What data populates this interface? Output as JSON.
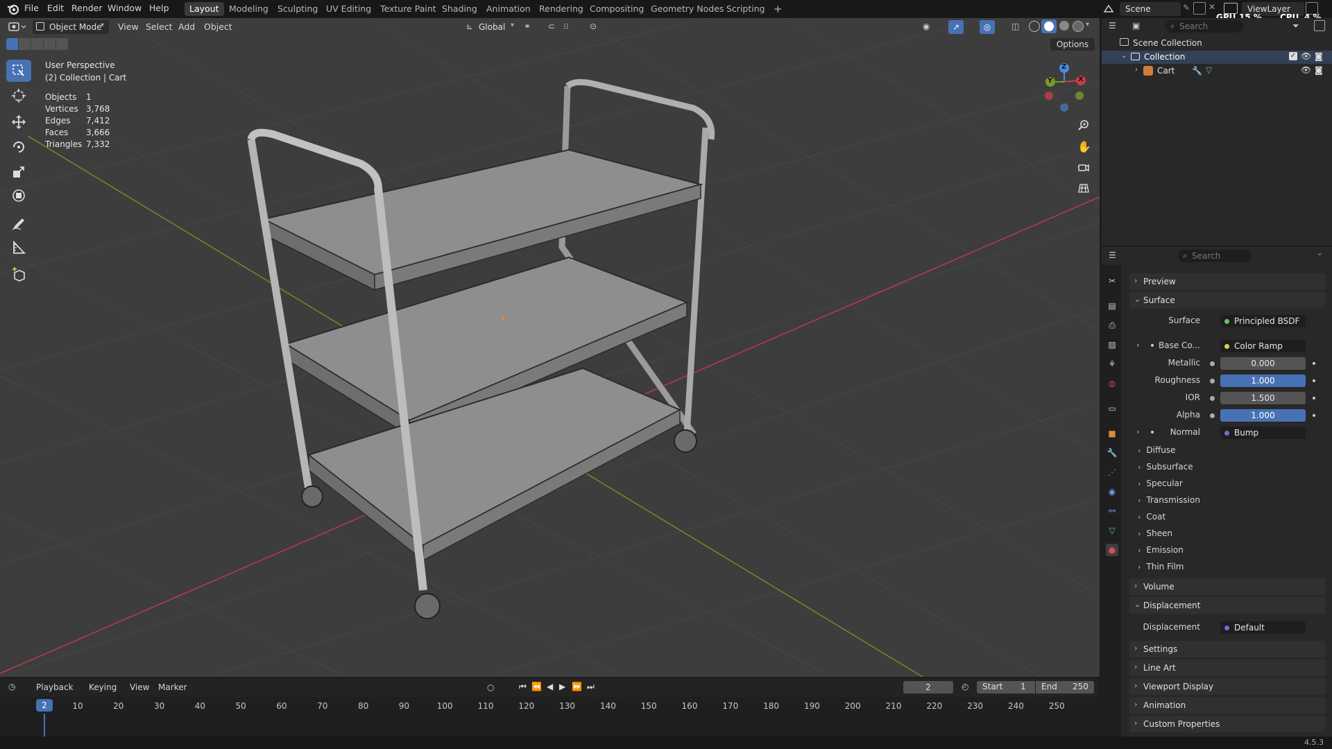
{
  "topbar": {
    "menu": [
      "File",
      "Edit",
      "Render",
      "Window",
      "Help"
    ],
    "workspaces": [
      "Layout",
      "Modeling",
      "Sculpting",
      "UV Editing",
      "Texture Paint",
      "Shading",
      "Animation",
      "Rendering",
      "Compositing",
      "Geometry Nodes",
      "Scripting"
    ],
    "active_workspace": "Layout",
    "add_tab": "+",
    "scene_name": "Scene",
    "view_layer": "ViewLayer",
    "gpu_label": "GPU",
    "gpu_value": "15 %",
    "cpu_label": "CPU",
    "cpu_value": "4 %"
  },
  "viewport_header": {
    "mode": "Object Mode",
    "menus": [
      "View",
      "Select",
      "Add",
      "Object"
    ],
    "transform_orientation": "Global",
    "options_label": "Options"
  },
  "viewport": {
    "perspective": "User Perspective",
    "collection_info": "(2) Collection | Cart",
    "stats": [
      {
        "label": "Objects",
        "value": "1"
      },
      {
        "label": "Vertices",
        "value": "3,768"
      },
      {
        "label": "Edges",
        "value": "7,412"
      },
      {
        "label": "Faces",
        "value": "3,666"
      },
      {
        "label": "Triangles",
        "value": "7,332"
      }
    ],
    "gizmo": {
      "x": "X",
      "y": "Y",
      "z": "Z"
    }
  },
  "outliner": {
    "search_placeholder": "Search",
    "scene_collection": "Scene Collection",
    "collection": "Collection",
    "object": "Cart"
  },
  "properties": {
    "search_placeholder": "Search",
    "preview": "Preview",
    "surface_panel": "Surface",
    "surface_label": "Surface",
    "surface_value": "Principled BSDF",
    "rows": [
      {
        "label": "Base Co...",
        "value": "Color Ramp"
      },
      {
        "label": "Metallic",
        "value": "0.000"
      },
      {
        "label": "Roughness",
        "value": "1.000"
      },
      {
        "label": "IOR",
        "value": "1.500"
      },
      {
        "label": "Alpha",
        "value": "1.000"
      },
      {
        "label": "Normal",
        "value": "Bump"
      }
    ],
    "subpanels": [
      "Diffuse",
      "Subsurface",
      "Specular",
      "Transmission",
      "Coat",
      "Sheen",
      "Emission",
      "Thin Film"
    ],
    "volume": "Volume",
    "displacement_panel": "Displacement",
    "displacement_label": "Displacement",
    "displacement_value": "Default",
    "bottom_panels": [
      "Settings",
      "Line Art",
      "Viewport Display",
      "Animation",
      "Custom Properties"
    ]
  },
  "timeline": {
    "menus": [
      "Playback",
      "Keying",
      "View",
      "Marker"
    ],
    "current_frame": "2",
    "start_label": "Start",
    "start_value": "1",
    "end_label": "End",
    "end_value": "250",
    "ticks": [
      "10",
      "20",
      "30",
      "40",
      "50",
      "60",
      "70",
      "80",
      "90",
      "100",
      "110",
      "120",
      "130",
      "140",
      "150",
      "160",
      "170",
      "180",
      "190",
      "200",
      "210",
      "220",
      "230",
      "240",
      "250"
    ]
  },
  "statusbar": {
    "version": "4.5.3"
  },
  "colors": {
    "accent": "#4772b3",
    "viewport_bg": "#3d3d3d",
    "x_axis": "#c83c4a",
    "y_axis": "#7a9a2a",
    "z_axis": "#4a8be0"
  }
}
